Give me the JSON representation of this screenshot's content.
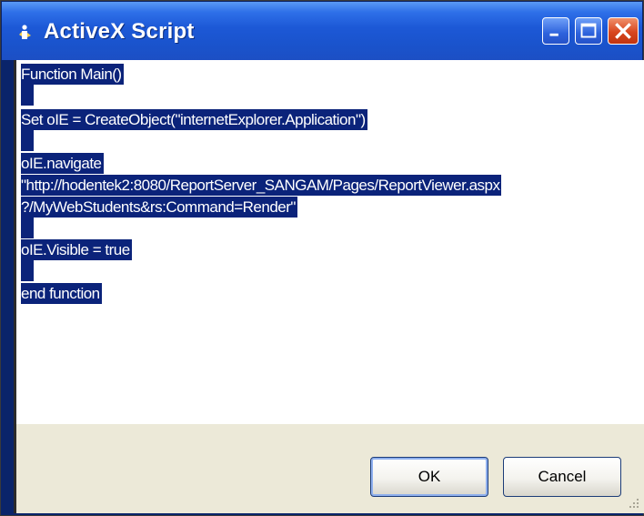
{
  "window": {
    "title": "ActiveX Script",
    "title_bar_color": "#1c58d6",
    "controls": {
      "minimize": "minimize-icon",
      "maximize": "maximize-icon",
      "close": "close-icon"
    }
  },
  "editor": {
    "selection_color": "#0b237a",
    "lines": [
      "Function Main()",
      "",
      "Set oIE = CreateObject(\"internetExplorer.Application\")",
      "",
      "oIE.navigate",
      "\"http://hodentek2:8080/ReportServer_SANGAM/Pages/ReportViewer.aspx",
      "?/MyWebStudents&rs:Command=Render\"",
      "",
      "oIE.Visible = true",
      "",
      "end function"
    ]
  },
  "buttons": {
    "ok_label": "OK",
    "cancel_label": "Cancel"
  }
}
